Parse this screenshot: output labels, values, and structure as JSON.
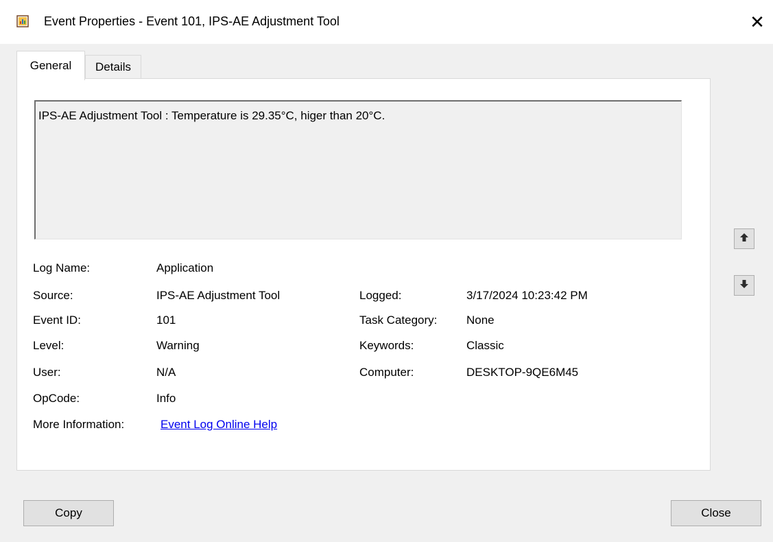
{
  "window": {
    "title": "Event Properties - Event 101, IPS-AE Adjustment Tool",
    "close_glyph": "✕"
  },
  "tabs": [
    {
      "label": "General",
      "active": true
    },
    {
      "label": "Details",
      "active": false
    }
  ],
  "message": "IPS-AE Adjustment Tool : Temperature is 29.35°C, higer than 20°C.",
  "fields_left": [
    {
      "label": "Log Name:",
      "value": "Application"
    },
    {
      "label": "Source:",
      "value": "IPS-AE Adjustment Tool"
    },
    {
      "label": "Event ID:",
      "value": "101"
    },
    {
      "label": "Level:",
      "value": "Warning"
    },
    {
      "label": "User:",
      "value": "N/A"
    },
    {
      "label": "OpCode:",
      "value": "Info"
    },
    {
      "label": "More Information:",
      "value": "Event Log Online Help"
    }
  ],
  "fields_right": [
    {
      "label": "Logged:",
      "value": "3/17/2024 10:23:42 PM"
    },
    {
      "label": "Task Category:",
      "value": "None"
    },
    {
      "label": "Keywords:",
      "value": "Classic"
    },
    {
      "label": "Computer:",
      "value": "DESKTOP-9QE6M45"
    }
  ],
  "buttons": {
    "copy": "Copy",
    "close": "Close"
  },
  "icons": {
    "app": "event-viewer-icon",
    "up": "arrow-up-icon",
    "down": "arrow-down-icon"
  }
}
